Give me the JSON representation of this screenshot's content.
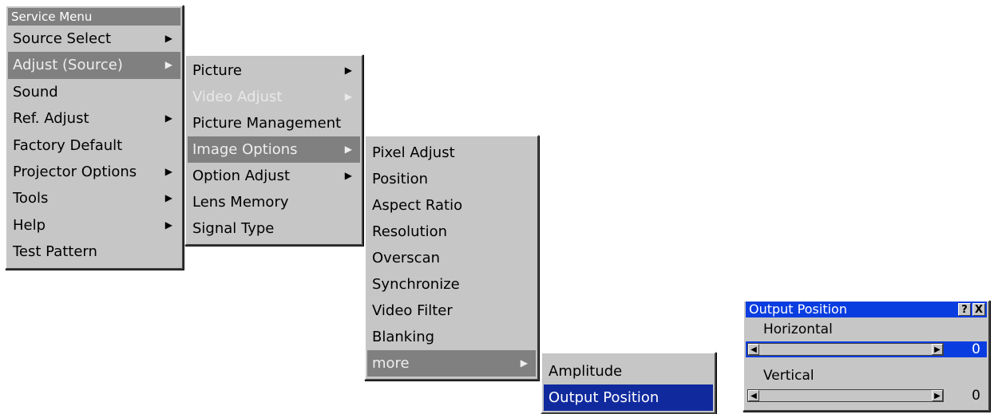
{
  "service_menu": {
    "title": "Service Menu",
    "items": [
      {
        "label": "Source Select",
        "arrow": "▶"
      },
      {
        "label": "Adjust (Source)",
        "arrow": "▶"
      },
      {
        "label": "Sound"
      },
      {
        "label": "Ref. Adjust",
        "arrow": "▶"
      },
      {
        "label": "Factory Default"
      },
      {
        "label": "Projector Options",
        "arrow": "▶"
      },
      {
        "label": "Tools",
        "arrow": "▶"
      },
      {
        "label": "Help",
        "arrow": "▶"
      },
      {
        "label": "Test Pattern"
      }
    ]
  },
  "adjust_menu": {
    "items": [
      {
        "label": "Picture",
        "arrow": "▶"
      },
      {
        "label": "Video Adjust",
        "arrow": "▶"
      },
      {
        "label": "Picture Management"
      },
      {
        "label": "Image Options",
        "arrow": "▶"
      },
      {
        "label": "Option Adjust",
        "arrow": "▶"
      },
      {
        "label": "Lens Memory"
      },
      {
        "label": "Signal Type"
      }
    ]
  },
  "image_options_menu": {
    "items": [
      {
        "label": "Pixel Adjust"
      },
      {
        "label": "Position"
      },
      {
        "label": "Aspect Ratio"
      },
      {
        "label": "Resolution"
      },
      {
        "label": "Overscan"
      },
      {
        "label": "Synchronize"
      },
      {
        "label": "Video Filter"
      },
      {
        "label": "Blanking"
      },
      {
        "label": "more",
        "arrow": "▶"
      }
    ]
  },
  "more_menu": {
    "items": [
      {
        "label": "Amplitude"
      },
      {
        "label": "Output Position"
      }
    ]
  },
  "output_dialog": {
    "title": "Output Position",
    "help_icon": "?",
    "close_icon": "X",
    "horizontal_label": "Horizontal",
    "horizontal_value": "0",
    "vertical_label": "Vertical",
    "vertical_value": "0",
    "left_arrow": "◀",
    "right_arrow": "▶"
  },
  "colors": {
    "menu_bg": "#c6c6c6",
    "highlight_gray": "#808080",
    "selection_blue": "#102a9e",
    "title_blue": "#0a3de0"
  }
}
